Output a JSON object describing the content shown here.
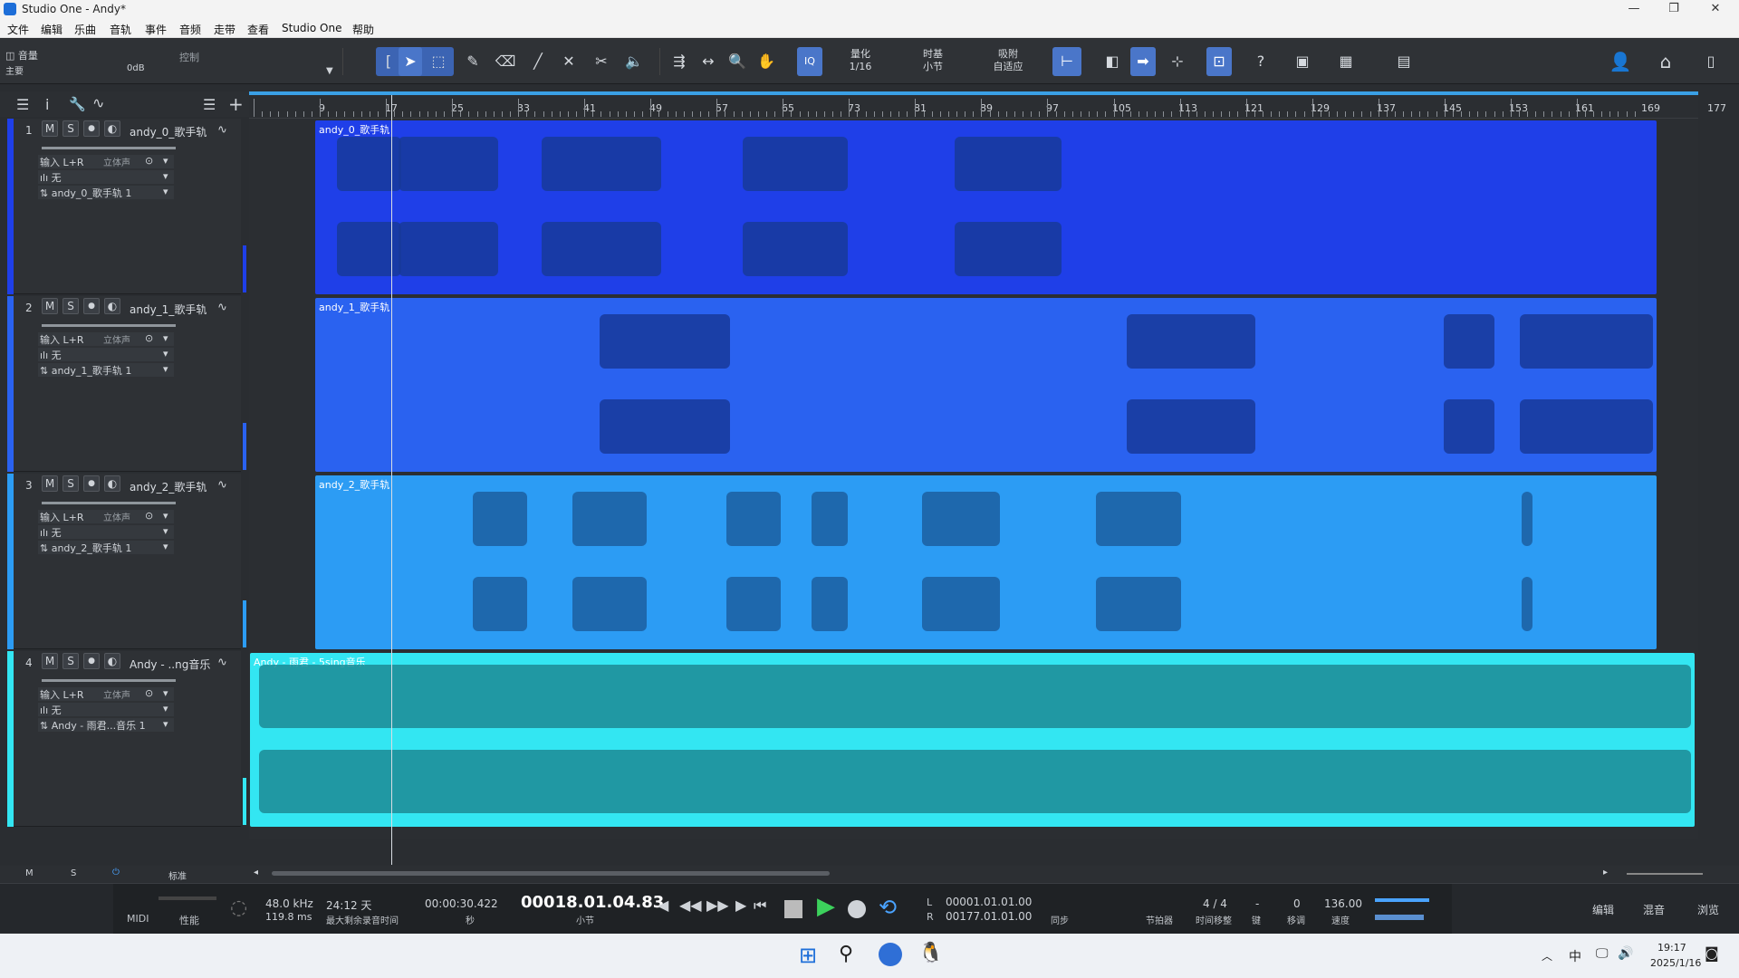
{
  "app": {
    "title": "Studio One - Andy*"
  },
  "menu": [
    "文件",
    "编辑",
    "乐曲",
    "音轨",
    "事件",
    "音频",
    "走带",
    "查看",
    "Studio One",
    "帮助"
  ],
  "left_panel": {
    "mode": "音量",
    "control_label": "控制",
    "channel": "主要",
    "gain": "0dB"
  },
  "toolbar": {
    "quantize_label": "量化",
    "quantize_value": "1/16",
    "timebase_label": "时基",
    "timebase_value": "小节",
    "snap_label": "吸附",
    "snap_value": "自适应",
    "iq": "IQ",
    "help": "?"
  },
  "ruler": {
    "labels": [
      "9",
      "17",
      "25",
      "33",
      "41",
      "49",
      "57",
      "65",
      "73",
      "81",
      "89",
      "97",
      "105",
      "113",
      "121",
      "129",
      "137",
      "145",
      "153",
      "161",
      "169",
      "177"
    ]
  },
  "tracks": [
    {
      "num": "1",
      "name": "andy_0_歌手轨",
      "input": "输入 L+R",
      "mode": "立体声",
      "insert": "无",
      "output": "andy_0_歌手轨 1",
      "color": "#1f3fe8",
      "event": "andy_0_歌手轨"
    },
    {
      "num": "2",
      "name": "andy_1_歌手轨",
      "input": "输入 L+R",
      "mode": "立体声",
      "insert": "无",
      "output": "andy_1_歌手轨 1",
      "color": "#2a62f0",
      "event": "andy_1_歌手轨"
    },
    {
      "num": "3",
      "name": "andy_2_歌手轨",
      "input": "输入 L+R",
      "mode": "立体声",
      "insert": "无",
      "output": "andy_2_歌手轨 1",
      "color": "#2c9cf4",
      "event": "andy_2_歌手轨"
    },
    {
      "num": "4",
      "name": "Andy - ..ng音乐",
      "input": "输入 L+R",
      "mode": "立体声",
      "insert": "无",
      "output": "Andy - 雨君...音乐 1",
      "color": "#33e6f2",
      "event": "Andy - 雨君 - 5sing音乐"
    }
  ],
  "track_buttons": {
    "m": "M",
    "s": "S",
    "rec": "●",
    "mon": "◐"
  },
  "bottom": {
    "m": "M",
    "s": "S",
    "view": "标准"
  },
  "transport": {
    "midi": "MIDI",
    "perf": "性能",
    "sample_rate": "48.0 kHz",
    "latency": "119.8 ms",
    "record_time": "24:12 天",
    "record_time_label": "最大剩余录音时间",
    "seconds": "00:00:30.422",
    "seconds_label": "秒",
    "bars": "00018.01.04.83",
    "bars_label": "小节",
    "loop_l": "00001.01.01.00",
    "loop_r": "00177.01.01.00",
    "l": "L",
    "r": "R",
    "sync": "同步",
    "metronome": "节拍器",
    "timesig": "4 / 4",
    "timesig_label": "时间移整",
    "key": "-",
    "key_label": "键",
    "transpose": "0",
    "transpose_label": "移调",
    "tempo": "136.00",
    "tempo_label": "速度",
    "edit": "编辑",
    "mix": "混音",
    "browse": "浏览"
  },
  "taskbar": {
    "time": "19:17",
    "date": "2025/1/16",
    "ime": "中"
  }
}
